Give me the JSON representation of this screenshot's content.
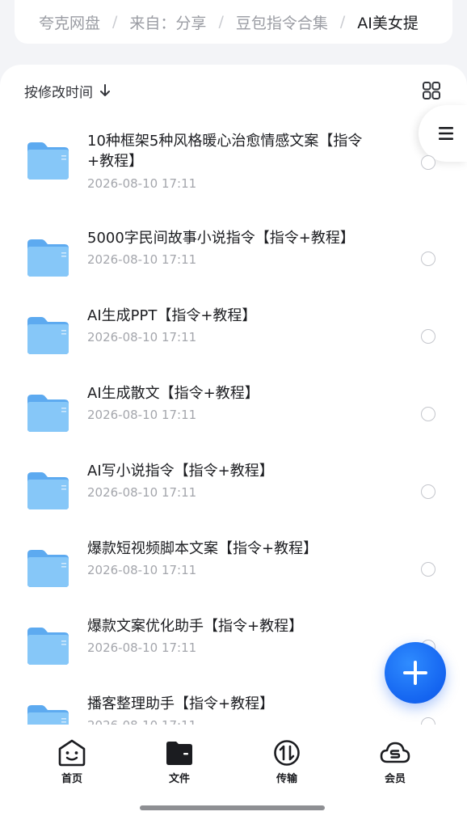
{
  "breadcrumb": {
    "items": [
      "夸克网盘",
      "来自：分享",
      "豆包指令合集",
      "AI美女提"
    ]
  },
  "toolbar": {
    "sort_label": "按修改时间",
    "sort_icon": "arrow-down-icon",
    "view_icon": "grid-view-icon",
    "side_menu_icon": "menu-icon"
  },
  "files": [
    {
      "name": "10种框架5种风格暖心治愈情感文案【指令+教程】",
      "date": "2026-08-10 17:11"
    },
    {
      "name": "5000字民间故事小说指令【指令+教程】",
      "date": "2026-08-10 17:11"
    },
    {
      "name": "AI生成PPT【指令+教程】",
      "date": "2026-08-10 17:11"
    },
    {
      "name": "AI生成散文【指令+教程】",
      "date": "2026-08-10 17:11"
    },
    {
      "name": "AI写小说指令【指令+教程】",
      "date": "2026-08-10 17:11"
    },
    {
      "name": "爆款短视频脚本文案【指令+教程】",
      "date": "2026-08-10 17:11"
    },
    {
      "name": "爆款文案优化助手【指令+教程】",
      "date": "2026-08-10 17:11"
    },
    {
      "name": "播客整理助手【指令+教程】",
      "date": "2026-08-10 17:11"
    }
  ],
  "fab": {
    "icon": "plus-icon"
  },
  "tabs": [
    {
      "label": "首页",
      "icon": "smile-face-icon"
    },
    {
      "label": "文件",
      "icon": "folder-filled-icon"
    },
    {
      "label": "传输",
      "icon": "transfer-arrows-icon"
    },
    {
      "label": "会员",
      "icon": "cloud-s-icon"
    }
  ],
  "colors": {
    "accent": "#1464f0",
    "folder": "#7cc0f5",
    "background": "#f3f4f7"
  }
}
